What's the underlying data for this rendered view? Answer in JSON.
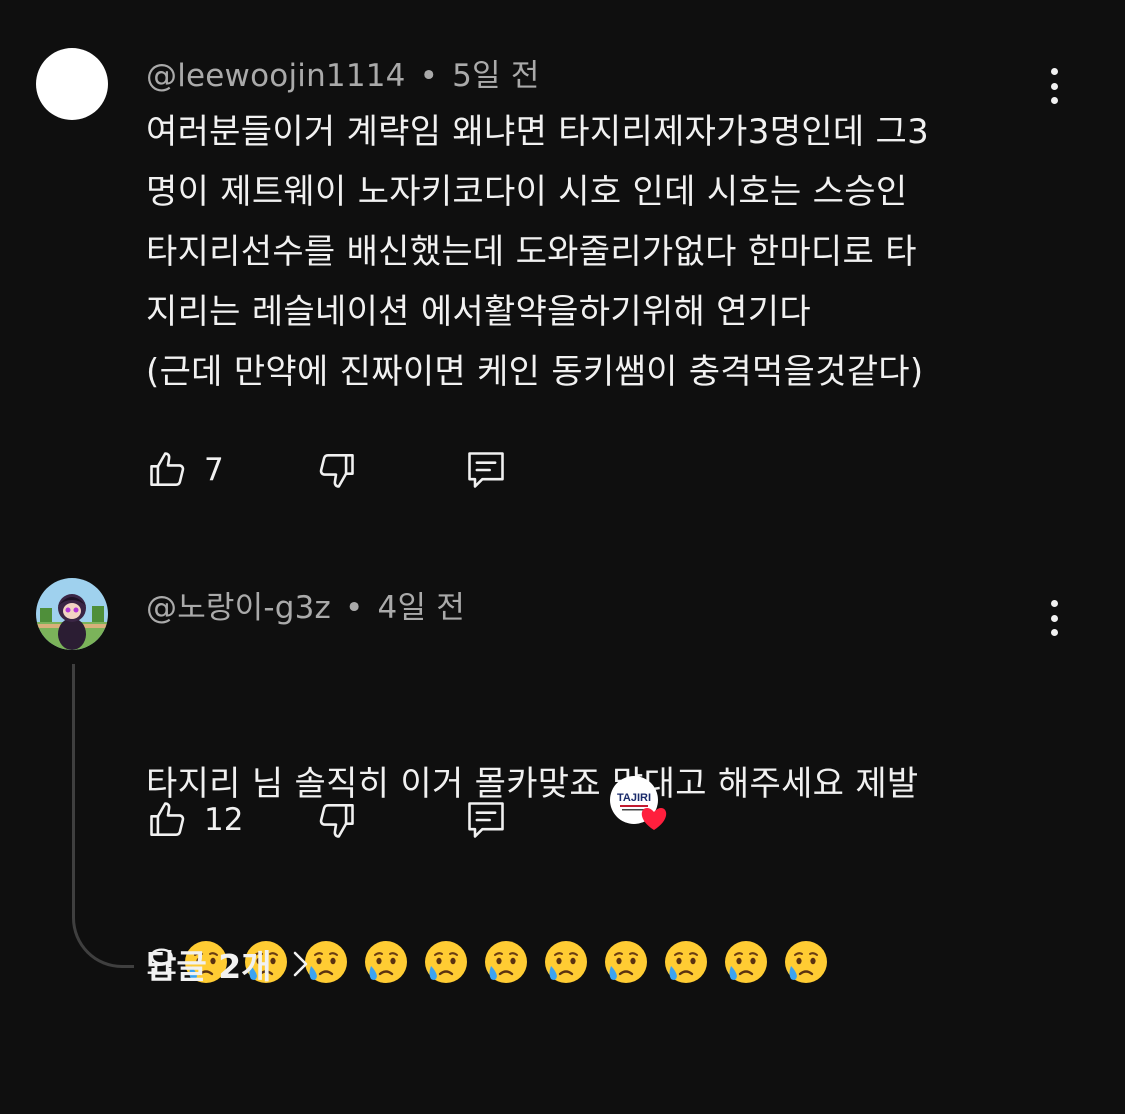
{
  "comments": [
    {
      "author": "@leewoojin1114",
      "time": "5일 전",
      "text": "여러분들이거 계략임 왜냐면 타지리제자가3명인데 그3\n명이 제트웨이 노자키코다이 시호 인데 시호는 스승인\n타지리선수를 배신했는데 도와줄리가없다 한마디로 타\n지리는 레슬네이션 에서활약을하기위해 연기다\n(근데 만약에 진짜이면 케인 동키쌤이 충격먹을것같다)",
      "likes": "7"
    },
    {
      "author": "@노랑이-g3z",
      "time": "4일 전",
      "text_line1": "타지리 님 솔직히 이거 몰카맞죠 맞대고 해주세요 제발",
      "text_line2_prefix": "요",
      "emoji_count": 11,
      "likes": "12",
      "creator_badge_text": "TAJIRI"
    }
  ],
  "replies_label": "답글 2개",
  "colors": {
    "background": "#0f0f0f",
    "text": "#f1f1f1",
    "meta": "#aaaaaa",
    "heart": "#ff1f3d",
    "thread_line": "#3f3f3f"
  },
  "icons": {
    "like": "thumb-up-icon",
    "dislike": "thumb-down-icon",
    "reply": "reply-comment-icon",
    "more": "more-vertical-icon",
    "chevron": "chevron-right-icon",
    "emoji": "crying-face-emoji"
  }
}
